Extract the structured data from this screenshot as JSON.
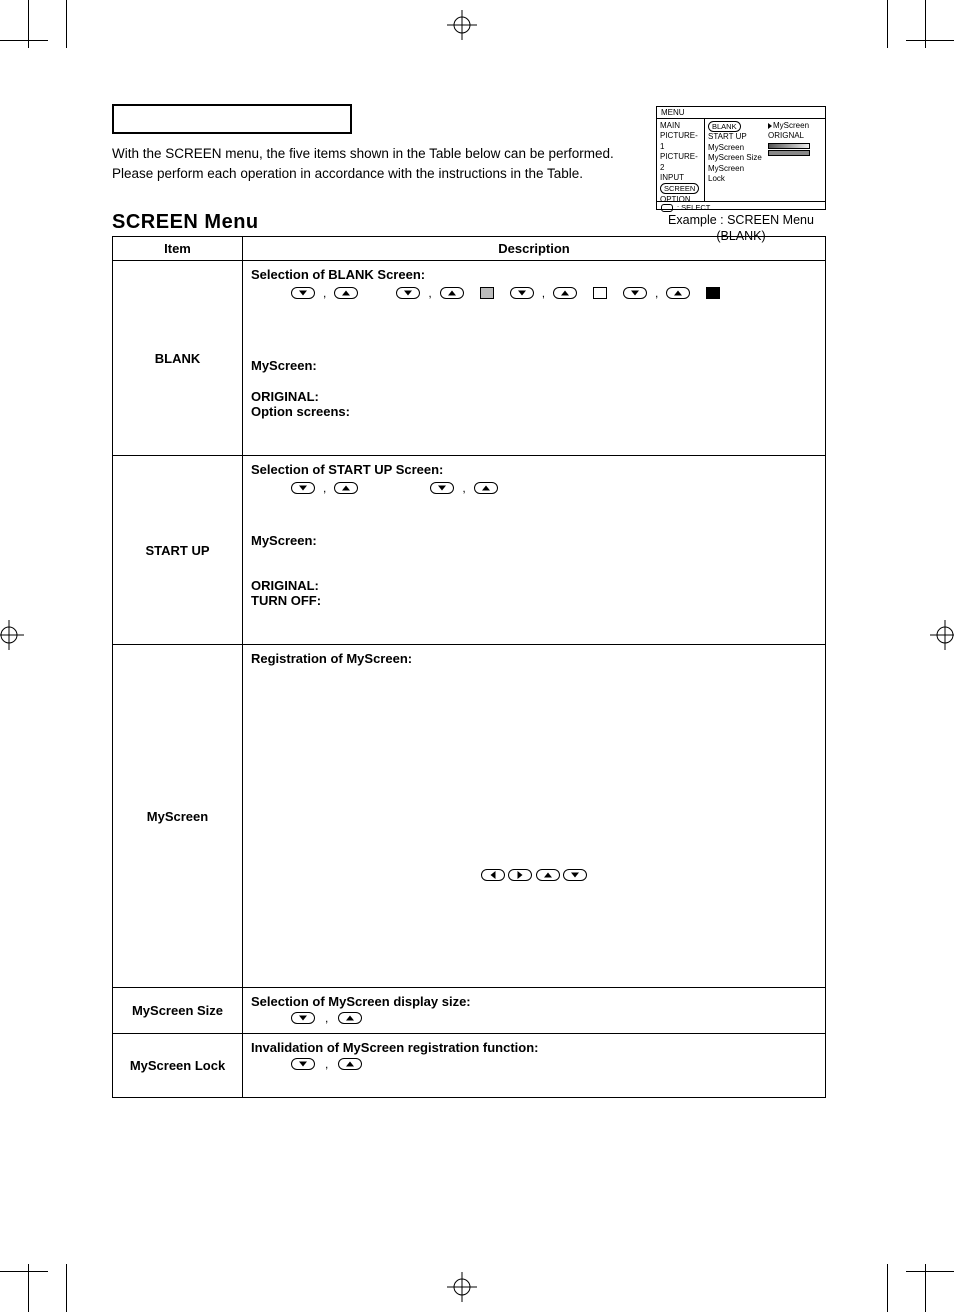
{
  "intro_line1": "With the SCREEN menu, the five items shown in the Table below can be performed.",
  "intro_line2": "Please perform each operation in accordance with the instructions in the Table.",
  "section_title": "SCREEN Menu",
  "table": {
    "headers": {
      "item": "Item",
      "description": "Description"
    },
    "rows": {
      "blank": {
        "item": "BLANK",
        "sel_head": "Selection of BLANK Screen:",
        "myscreen": "MyScreen:",
        "original": "ORIGINAL:",
        "option": "Option screens:"
      },
      "startup": {
        "item": "START UP",
        "sel_head": "Selection of START UP Screen:",
        "myscreen": "MyScreen:",
        "original": "ORIGINAL:",
        "turnoff": "TURN OFF:"
      },
      "myscreen": {
        "item": "MyScreen",
        "head": "Registration of MyScreen:"
      },
      "myscreen_size": {
        "item": "MyScreen Size",
        "head": "Selection of MyScreen display size:"
      },
      "myscreen_lock": {
        "item": "MyScreen Lock",
        "head": "Invalidation of MyScreen registration function:"
      }
    }
  },
  "example": {
    "menu_label": "MENU",
    "col1": [
      "MAIN",
      "PICTURE-1",
      "PICTURE-2",
      "INPUT",
      "SCREEN",
      "OPTION"
    ],
    "col2": [
      "BLANK",
      "START UP",
      "MyScreen",
      "MyScreen Size",
      "MyScreen Lock"
    ],
    "col3_myscr": "MyScreen",
    "col3_orig": "ORIGNAL",
    "footer": ": SELECT",
    "caption_line1": "Example : SCREEN Menu",
    "caption_line2": "(BLANK)"
  }
}
